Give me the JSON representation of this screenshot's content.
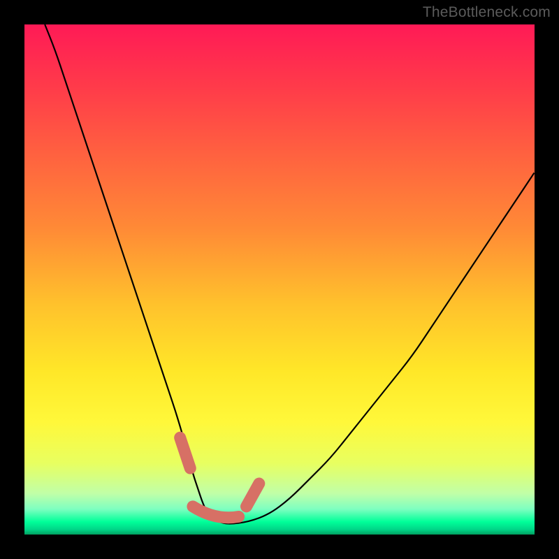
{
  "watermark": "TheBottleneck.com",
  "chart_data": {
    "type": "line",
    "title": "",
    "xlabel": "",
    "ylabel": "",
    "xlim": [
      0,
      100
    ],
    "ylim": [
      0,
      100
    ],
    "series": [
      {
        "name": "bottleneck-curve",
        "x": [
          4,
          6,
          8,
          10,
          12,
          14,
          16,
          18,
          20,
          22,
          24,
          26,
          28,
          30,
          32,
          33,
          34,
          35,
          36,
          38,
          40,
          44,
          48,
          52,
          56,
          60,
          64,
          68,
          72,
          76,
          80,
          84,
          88,
          92,
          96,
          100
        ],
        "y": [
          100,
          95,
          89,
          83,
          77,
          71,
          65,
          59,
          53,
          47,
          41,
          35,
          29,
          23,
          16,
          12,
          9,
          6,
          4,
          2.5,
          2,
          2.5,
          4,
          7,
          11,
          15,
          20,
          25,
          30,
          35,
          41,
          47,
          53,
          59,
          65,
          71
        ]
      }
    ],
    "highlight_segments": [
      {
        "name": "left-segment",
        "x": [
          30.5,
          32.5
        ],
        "y": [
          19,
          13
        ]
      },
      {
        "name": "bottom-segment",
        "x": [
          33.0,
          42.0
        ],
        "y": [
          5.5,
          3.5
        ]
      },
      {
        "name": "right-segment",
        "x": [
          43.5,
          46.0
        ],
        "y": [
          5.5,
          10
        ]
      }
    ],
    "colors": {
      "curve": "#000000",
      "highlight": "#d77065"
    }
  }
}
